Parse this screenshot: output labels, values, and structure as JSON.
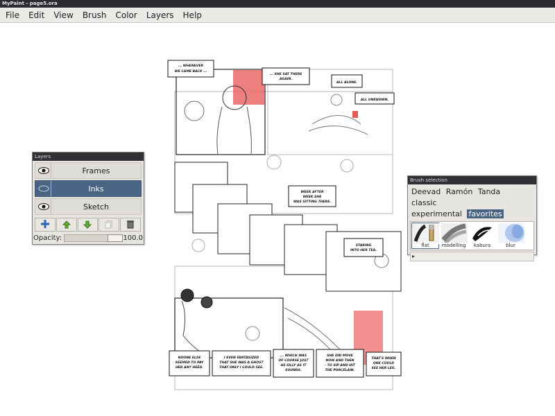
{
  "window": {
    "title": "MyPaint - page5.ora"
  },
  "menu": [
    "File",
    "Edit",
    "View",
    "Brush",
    "Color",
    "Layers",
    "Help"
  ],
  "comic_captions": [
    [
      "... WHENEVER",
      "WE CAME BACK ..."
    ],
    [
      "... SHE SAT THERE",
      "AGAIN."
    ],
    [
      "ALL ALONE."
    ],
    [
      "ALL UNKNOWN."
    ],
    [
      "WEEK AFTER",
      "WEEK SHE",
      "WAS SITTING THERE."
    ],
    [
      "STARING",
      "INTO HER TEA."
    ],
    [
      "NOONE ELSE",
      "SEEMED TO PAY",
      "HER ANY HEED."
    ],
    [
      "I EVEN FANTASIZED",
      "THAT SHE WAS A GHOST",
      "THAT ONLY I COULD SEE."
    ],
    [
      "... WHICH WAS",
      "OF COURSE JUST",
      "AS SILLY AS IT",
      "SOUNDS."
    ],
    [
      "SHE DID MOVE",
      "NOW AND THEN",
      "- TO SIP AND HIT",
      "THE PORCELAIN."
    ],
    [
      "THAT'S WHEN",
      "ONE COULD",
      "SEE HER LEG."
    ]
  ],
  "layers_panel": {
    "title": "Layers",
    "layers": [
      {
        "name": "Frames",
        "visible_icon": "eye-icon",
        "selected": false
      },
      {
        "name": "Inks",
        "visible_icon": "hidden-eye-icon",
        "selected": true
      },
      {
        "name": "Sketch",
        "visible_icon": "eye-icon",
        "selected": false
      }
    ],
    "buttons": [
      "add-layer-icon",
      "move-layer-up-icon",
      "move-layer-down-icon",
      "duplicate-layer-icon",
      "delete-layer-icon"
    ],
    "opacity_label": "Opacity:",
    "opacity_value": "100.0",
    "opacity": 1.0
  },
  "brush_panel": {
    "title": "Brush selection",
    "groups": [
      "Deevad",
      "Ramón",
      "Tanda",
      "classic",
      "experimental",
      "favorites"
    ],
    "selected_group": "favorites",
    "brushes": [
      {
        "name": "flat",
        "selected": true
      },
      {
        "name": "modelling",
        "selected": false
      },
      {
        "name": "kabura",
        "selected": false
      },
      {
        "name": "blur",
        "selected": false
      }
    ],
    "footer": "▸"
  },
  "colors": {
    "selection": "#4a6584",
    "accent_red": "#e85a5a"
  }
}
